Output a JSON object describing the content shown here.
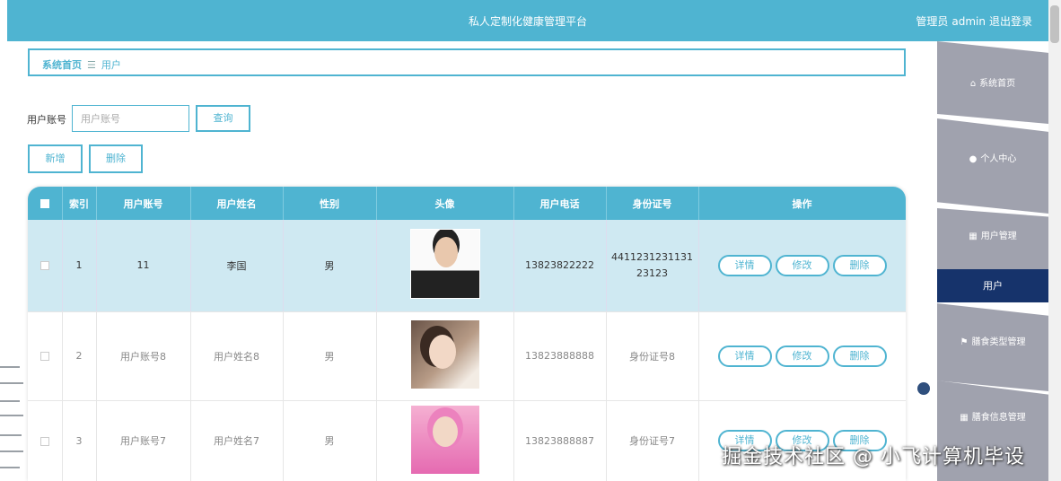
{
  "header": {
    "title": "私人定制化健康管理平台",
    "role": "管理员",
    "username": "admin",
    "logout": "退出登录"
  },
  "breadcrumb": {
    "home": "系统首页",
    "separator": "☰",
    "current": "用户"
  },
  "search": {
    "label": "用户账号",
    "placeholder": "用户账号",
    "query_label": "查询"
  },
  "actions": {
    "add_label": "新增",
    "delete_label": "删除"
  },
  "table": {
    "columns": [
      "索引",
      "用户账号",
      "用户姓名",
      "性别",
      "头像",
      "用户电话",
      "身份证号",
      "操作"
    ],
    "rows": [
      {
        "index": "1",
        "account": "11",
        "name": "李国",
        "gender": "男",
        "phone": "13823822222",
        "idcard": "4411231231131 23123"
      },
      {
        "index": "2",
        "account": "用户账号8",
        "name": "用户姓名8",
        "gender": "男",
        "phone": "13823888888",
        "idcard": "身份证号8"
      },
      {
        "index": "3",
        "account": "用户账号7",
        "name": "用户姓名7",
        "gender": "男",
        "phone": "13823888887",
        "idcard": "身份证号7"
      }
    ],
    "row_actions": {
      "detail": "详情",
      "edit": "修改",
      "delete": "删除"
    }
  },
  "sidebar": {
    "items": [
      {
        "label": "系统首页",
        "icon": "home-icon"
      },
      {
        "label": "个人中心",
        "icon": "person-icon"
      },
      {
        "label": "用户管理",
        "icon": "grid-icon"
      },
      {
        "label": "用户",
        "icon": ""
      },
      {
        "label": "膳食类型管理",
        "icon": "flag-icon"
      },
      {
        "label": "膳食信息管理",
        "icon": "grid-icon"
      }
    ]
  },
  "watermark": "掘金技术社区 @ 小飞计算机毕设",
  "colors": {
    "primary": "#4fb4d1",
    "sidebar_gray": "#a0a2ae",
    "sidebar_active": "#16336b",
    "selected_row": "#cfe9f2"
  }
}
